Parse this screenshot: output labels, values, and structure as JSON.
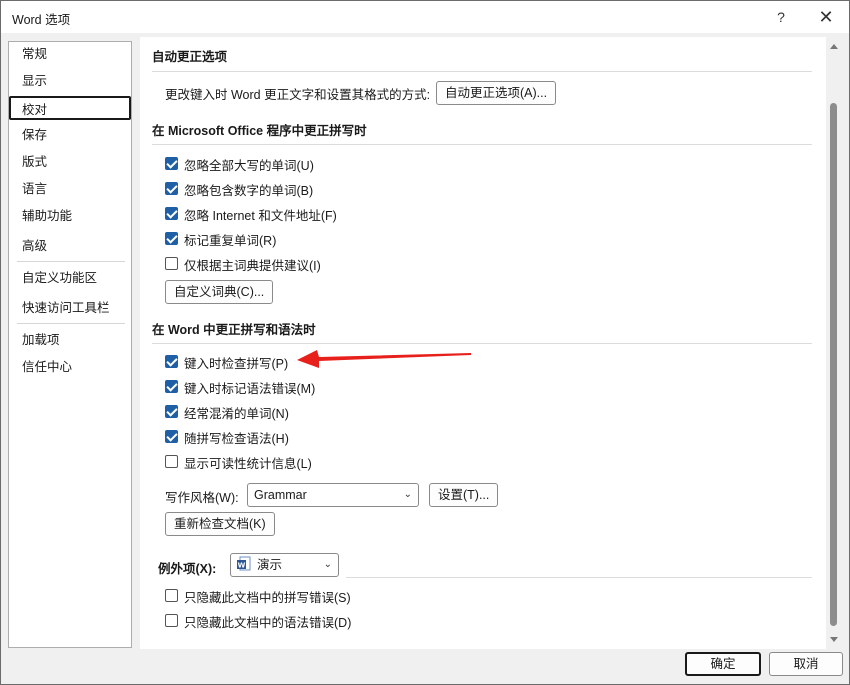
{
  "window": {
    "title": "Word 选项",
    "help_label": "?",
    "close_label": "✕"
  },
  "nav": {
    "items": [
      {
        "label": "常规"
      },
      {
        "label": "显示"
      },
      {
        "label": "校对"
      },
      {
        "label": "保存"
      },
      {
        "label": "版式"
      },
      {
        "label": "语言"
      },
      {
        "label": "辅助功能"
      },
      {
        "label": "高级"
      },
      {
        "label": "自定义功能区"
      },
      {
        "label": "快速访问工具栏"
      },
      {
        "label": "加载项"
      },
      {
        "label": "信任中心"
      }
    ],
    "selected": "校对"
  },
  "autocorrect": {
    "title": "自动更正选项",
    "desc": "更改键入时 Word 更正文字和设置其格式的方式:",
    "button": "自动更正选项(A)..."
  },
  "office_spelling": {
    "title": "在 Microsoft Office 程序中更正拼写时",
    "options": [
      {
        "label": "忽略全部大写的单词(U)",
        "checked": true
      },
      {
        "label": "忽略包含数字的单词(B)",
        "checked": true
      },
      {
        "label": "忽略 Internet 和文件地址(F)",
        "checked": true
      },
      {
        "label": "标记重复单词(R)",
        "checked": true
      },
      {
        "label": "仅根据主词典提供建议(I)",
        "checked": false
      }
    ],
    "custom_dict_button": "自定义词典(C)..."
  },
  "word_grammar": {
    "title": "在 Word 中更正拼写和语法时",
    "options": [
      {
        "label": "键入时检查拼写(P)",
        "checked": true
      },
      {
        "label": "键入时标记语法错误(M)",
        "checked": true
      },
      {
        "label": "经常混淆的单词(N)",
        "checked": true
      },
      {
        "label": "随拼写检查语法(H)",
        "checked": true
      },
      {
        "label": "显示可读性统计信息(L)",
        "checked": false
      }
    ],
    "style_label": "写作风格(W):",
    "style_value": "Grammar",
    "settings_button": "设置(T)...",
    "recheck_button": "重新检查文档(K)"
  },
  "exceptions": {
    "label": "例外项(X):",
    "doc_value": "演示",
    "options": [
      {
        "label": "只隐藏此文档中的拼写错误(S)",
        "checked": false
      },
      {
        "label": "只隐藏此文档中的语法错误(D)",
        "checked": false
      }
    ]
  },
  "footer": {
    "ok": "确定",
    "cancel": "取消"
  },
  "colors": {
    "checkbox": "#1f5fa6",
    "arrow": "#e8201c"
  },
  "icons": {
    "help": "help-icon",
    "close": "close-icon",
    "doc": "word-document-icon"
  }
}
